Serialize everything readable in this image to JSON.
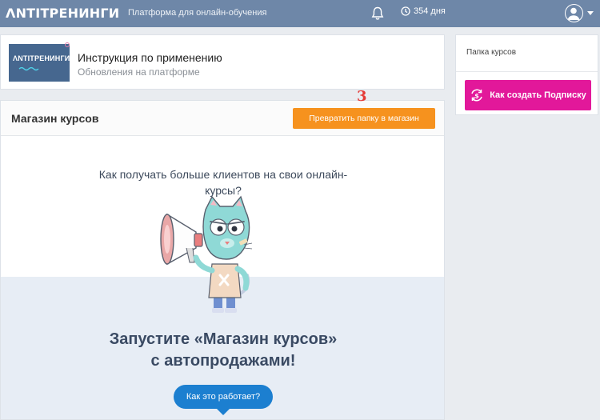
{
  "topbar": {
    "brand": "ΛNTITPEHИНГИ",
    "tagline": "Платформа для онлайн-обучения",
    "days": "354 дня",
    "icons": {
      "notifications": "bell-icon",
      "timer": "clock-icon",
      "profile": "user-icon"
    }
  },
  "info_card": {
    "thumb_title": "ΛNTITPEHИНГИ",
    "title": "Инструкция по применению",
    "subtitle": "Обновления на платформе"
  },
  "store": {
    "title": "Магазин курсов",
    "step_number": "3",
    "convert_label": "Превратить папку в магазин",
    "promo_question": "Как получать больше клиентов на свои онлайн-курсы?",
    "headline_line1": "Запустите «Магазин курсов»",
    "headline_line2": "с автопродажами!",
    "how_label": "Как это работает?"
  },
  "sidebar": {
    "folder_label": "Папка курсов",
    "subscription_label": "Как создать Подписку"
  },
  "colors": {
    "topbar": "#6e87a8",
    "orange_button": "#f6921e",
    "pink_button": "#e2189a",
    "blue_button": "#1c7fd0",
    "step_red": "#e53935"
  }
}
